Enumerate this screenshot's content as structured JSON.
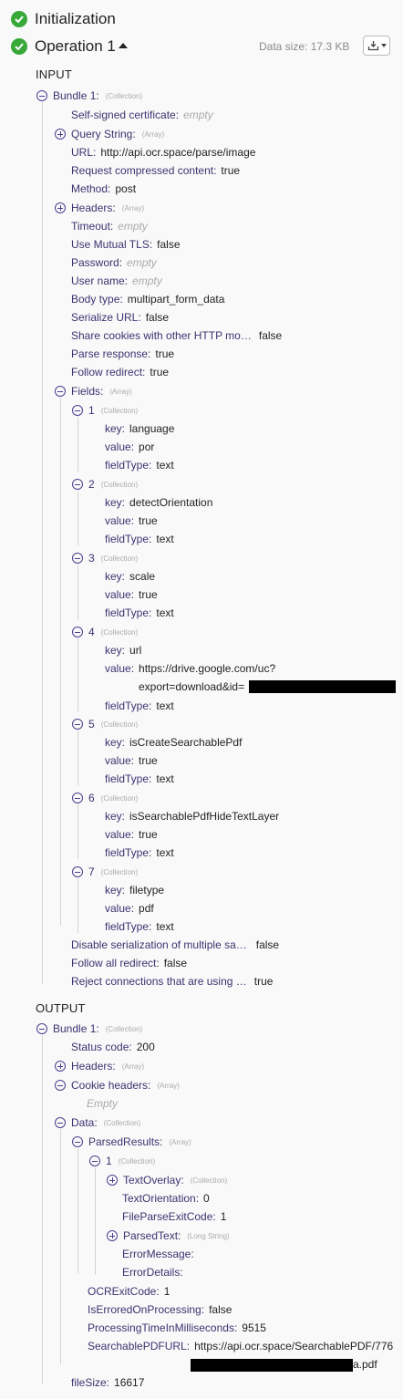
{
  "header": {
    "initialization_label": "Initialization",
    "operation_label": "Operation 1",
    "data_size": "Data size: 17.3 KB"
  },
  "icons": {
    "status": "check-circle-icon",
    "toggle_open": "minus-circle-icon",
    "toggle_closed": "plus-circle-icon",
    "download": "download-icon"
  },
  "colors": {
    "success": "#38a838",
    "key": "#3b3370",
    "type": "#aaaaaa"
  },
  "input": {
    "label": "INPUT",
    "bundle": {
      "label": "Bundle 1:",
      "type": "(Collection)"
    },
    "self_signed": {
      "key": "Self-signed certificate:",
      "value": "empty"
    },
    "query_string": {
      "key": "Query String:",
      "type": "(Array)"
    },
    "url": {
      "key": "URL:",
      "value": "http://api.ocr.space/parse/image"
    },
    "compressed": {
      "key": "Request compressed content:",
      "value": "true"
    },
    "method": {
      "key": "Method:",
      "value": "post"
    },
    "headers": {
      "key": "Headers:",
      "type": "(Array)"
    },
    "timeout": {
      "key": "Timeout:",
      "value": "empty"
    },
    "mutual_tls": {
      "key": "Use Mutual TLS:",
      "value": "false"
    },
    "password": {
      "key": "Password:",
      "value": "empty"
    },
    "username": {
      "key": "User name:",
      "value": "empty"
    },
    "body_type": {
      "key": "Body type:",
      "value": "multipart_form_data"
    },
    "serialize_url": {
      "key": "Serialize URL:",
      "value": "false"
    },
    "share_cookies": {
      "key": "Share cookies with other HTTP mo…",
      "value": "false"
    },
    "parse_response": {
      "key": "Parse response:",
      "value": "true"
    },
    "follow_redirect": {
      "key": "Follow redirect:",
      "value": "true"
    },
    "fields": {
      "key": "Fields:",
      "type": "(Array)"
    },
    "field_items": [
      {
        "index": "1",
        "type": "(Collection)",
        "key_label": "key:",
        "key_value": "language",
        "value_label": "value:",
        "value_value": "por",
        "ft_label": "fieldType:",
        "ft_value": "text"
      },
      {
        "index": "2",
        "type": "(Collection)",
        "key_label": "key:",
        "key_value": "detectOrientation",
        "value_label": "value:",
        "value_value": "true",
        "ft_label": "fieldType:",
        "ft_value": "text"
      },
      {
        "index": "3",
        "type": "(Collection)",
        "key_label": "key:",
        "key_value": "scale",
        "value_label": "value:",
        "value_value": "true",
        "ft_label": "fieldType:",
        "ft_value": "text"
      },
      {
        "index": "4",
        "type": "(Collection)",
        "key_label": "key:",
        "key_value": "url",
        "value_label": "value:",
        "value_value": "https://drive.google.com/uc?",
        "value_cont": "export=download&id=",
        "ft_label": "fieldType:",
        "ft_value": "text"
      },
      {
        "index": "5",
        "type": "(Collection)",
        "key_label": "key:",
        "key_value": "isCreateSearchablePdf",
        "value_label": "value:",
        "value_value": "true",
        "ft_label": "fieldType:",
        "ft_value": "text"
      },
      {
        "index": "6",
        "type": "(Collection)",
        "key_label": "key:",
        "key_value": "isSearchablePdfHideTextLayer",
        "value_label": "value:",
        "value_value": "true",
        "ft_label": "fieldType:",
        "ft_value": "text"
      },
      {
        "index": "7",
        "type": "(Collection)",
        "key_label": "key:",
        "key_value": "filetype",
        "value_label": "value:",
        "value_value": "pdf",
        "ft_label": "fieldType:",
        "ft_value": "text"
      }
    ],
    "disable_serialization": {
      "key": "Disable serialization of multiple sa…",
      "value": "false"
    },
    "follow_all_redirect": {
      "key": "Follow all redirect:",
      "value": "false"
    },
    "reject_connections": {
      "key": "Reject connections that are using …",
      "value": "true"
    }
  },
  "output": {
    "label": "OUTPUT",
    "bundle": {
      "label": "Bundle 1:",
      "type": "(Collection)"
    },
    "status_code": {
      "key": "Status code:",
      "value": "200"
    },
    "headers": {
      "key": "Headers:",
      "type": "(Array)"
    },
    "cookie_headers": {
      "key": "Cookie headers:",
      "type": "(Array)",
      "empty": "Empty"
    },
    "data": {
      "key": "Data:",
      "type": "(Collection)"
    },
    "parsed_results": {
      "key": "ParsedResults:",
      "type": "(Array)"
    },
    "result_1": {
      "index": "1",
      "type": "(Collection)"
    },
    "text_overlay": {
      "key": "TextOverlay:",
      "type": "(Collection)"
    },
    "text_orientation": {
      "key": "TextOrientation:",
      "value": "0"
    },
    "file_parse_exit": {
      "key": "FileParseExitCode:",
      "value": "1"
    },
    "parsed_text": {
      "key": "ParsedText:",
      "type": "(Long String)"
    },
    "error_message": {
      "key": "ErrorMessage:"
    },
    "error_details": {
      "key": "ErrorDetails:"
    },
    "ocr_exit": {
      "key": "OCRExitCode:",
      "value": "1"
    },
    "is_errored": {
      "key": "IsErroredOnProcessing:",
      "value": "false"
    },
    "processing_time": {
      "key": "ProcessingTimeInMilliseconds:",
      "value": "9515"
    },
    "searchable_pdf": {
      "key": "SearchablePDFURL:",
      "value": "https://api.ocr.space/SearchablePDF/776",
      "value_cont": "a.pdf"
    },
    "file_size": {
      "key": "fileSize:",
      "value": "16617"
    }
  }
}
